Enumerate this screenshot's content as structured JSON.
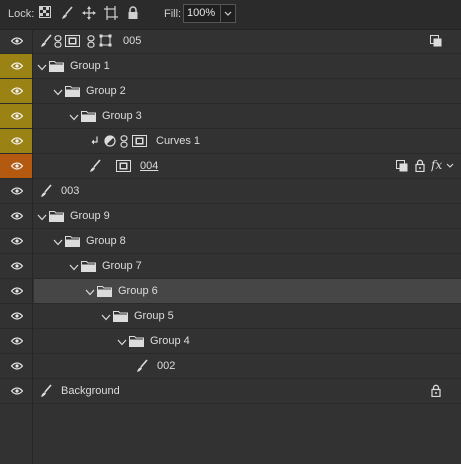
{
  "toolbar": {
    "lock_label": "Lock:",
    "fill_label": "Fill:",
    "fill_value": "100%",
    "icons": [
      "lock-transparent-pixels-icon",
      "lock-image-pixels-icon",
      "lock-position-icon",
      "lock-artboard-icon",
      "lock-all-icon"
    ]
  },
  "colors": {
    "panel_bg": "#323232",
    "tag_yellow": "#9b8214",
    "tag_orange": "#b35a10",
    "selected_row": "#464646"
  },
  "layers": [
    {
      "name": "005"
    },
    {
      "name": "Group 1"
    },
    {
      "name": "Group 2"
    },
    {
      "name": "Group 3"
    },
    {
      "name": "Curves 1"
    },
    {
      "name": "004"
    },
    {
      "name": "003"
    },
    {
      "name": "Group 9"
    },
    {
      "name": "Group 8"
    },
    {
      "name": "Group 7"
    },
    {
      "name": "Group 6"
    },
    {
      "name": "Group 5"
    },
    {
      "name": "Group 4"
    },
    {
      "name": "002"
    },
    {
      "name": "Background"
    }
  ]
}
